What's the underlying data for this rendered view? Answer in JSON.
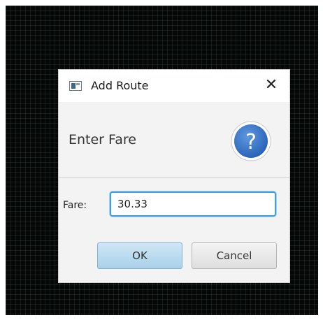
{
  "dialog": {
    "title": "Add Route",
    "close_glyph": "✕",
    "icon": "app-window-icon",
    "header_text": "Enter Fare",
    "header_icon": "help-question-icon",
    "help_glyph": "?",
    "field_label": "Fare:",
    "field_value": "30.33",
    "ok_label": "OK",
    "cancel_label": "Cancel"
  },
  "colors": {
    "focus_border": "#3ea0df",
    "help_icon_fill": "#2f6fc4",
    "ok_button": "#a9d1ea",
    "background_screen": "#050807"
  }
}
